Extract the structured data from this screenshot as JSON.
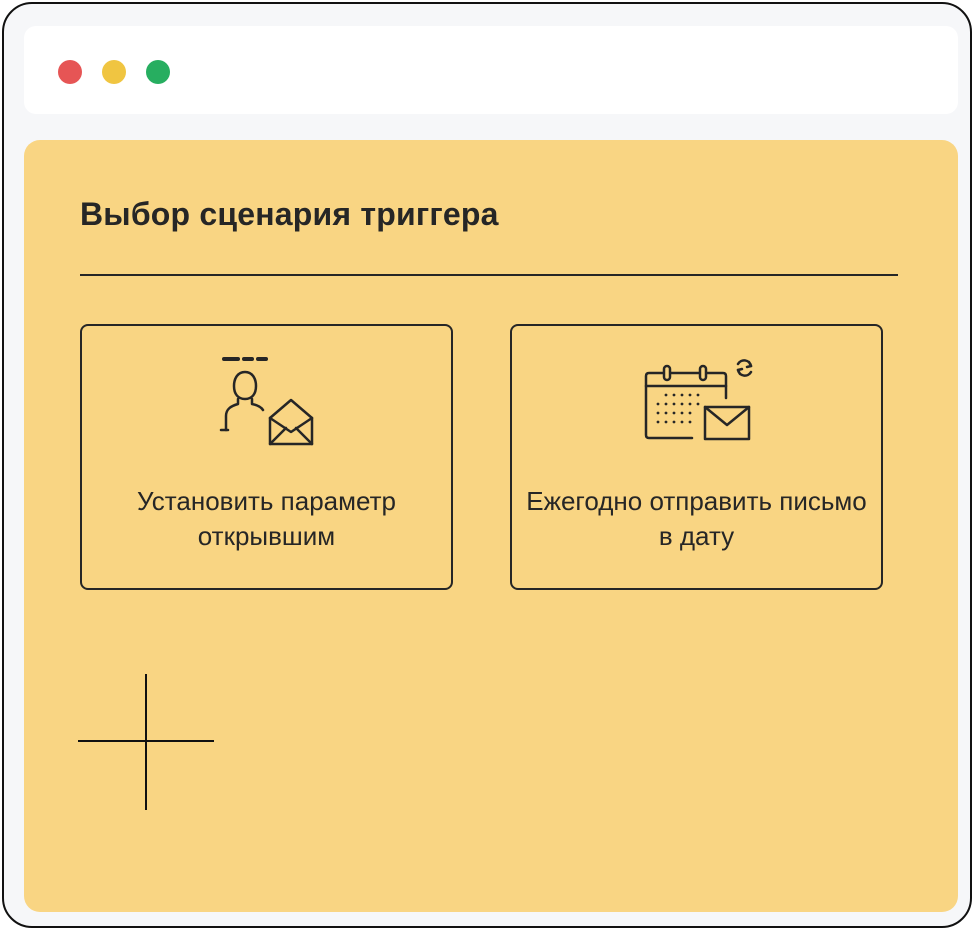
{
  "window": {
    "controls": [
      "close",
      "minimize",
      "maximize"
    ],
    "colors": {
      "close": "#e65555",
      "minimize": "#f0c541",
      "maximize": "#27ae60"
    }
  },
  "panel": {
    "title": "Выбор сценария триггера",
    "background": "#f9d583"
  },
  "cards": [
    {
      "label": "Установить параметр открывшим",
      "icon": "user-envelope-icon"
    },
    {
      "label": "Ежегодно отправить письмо в дату",
      "icon": "calendar-envelope-icon"
    }
  ],
  "add_button": {
    "icon": "plus-icon"
  }
}
